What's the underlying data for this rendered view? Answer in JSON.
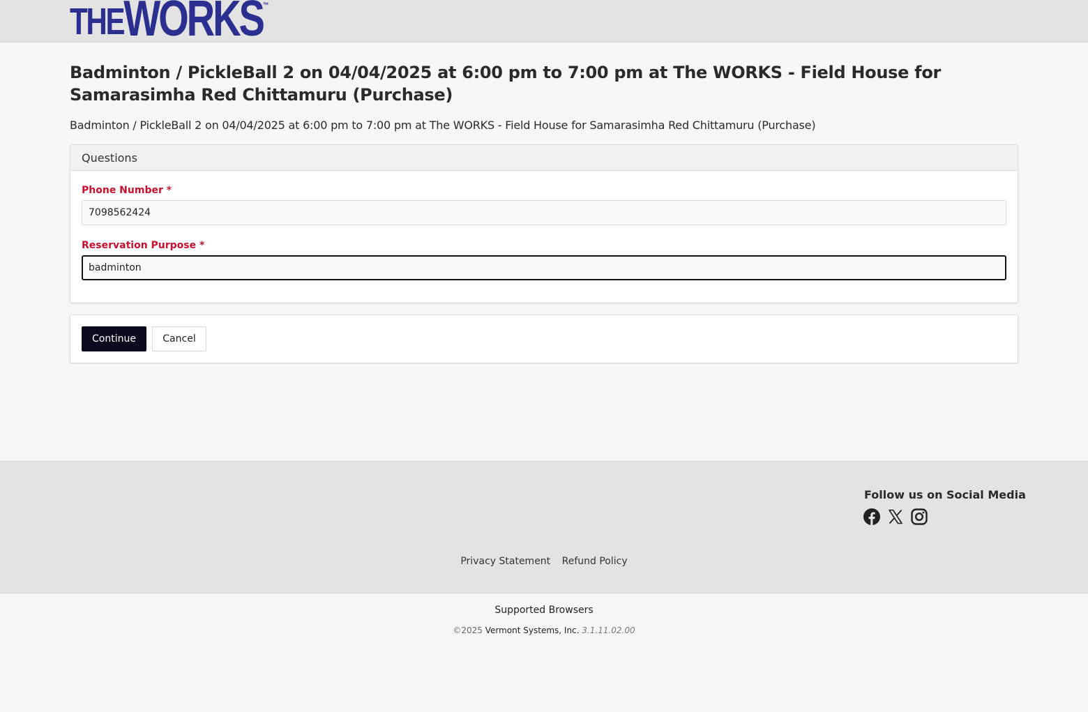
{
  "header": {
    "logo_the": "THE",
    "logo_works": "WORKS",
    "logo_tm": "™",
    "brand_color": "#2b2f8f"
  },
  "page": {
    "title": "Badminton / PickleBall 2 on 04/04/2025 at 6:00 pm to 7:00 pm at The WORKS - Field House for Samarasimha Red Chittamuru (Purchase)",
    "subtitle": "Badminton / PickleBall 2 on 04/04/2025 at 6:00 pm to 7:00 pm at The WORKS - Field House for Samarasimha Red Chittamuru (Purchase)"
  },
  "questions": {
    "heading": "Questions",
    "phone_label": "Phone Number *",
    "phone_value": "7098562424",
    "purpose_label": "Reservation Purpose *",
    "purpose_value": "badminton",
    "required_color": "#c8102e"
  },
  "actions": {
    "continue_label": "Continue",
    "cancel_label": "Cancel"
  },
  "footer": {
    "social_title": "Follow us on Social Media",
    "social_icons": [
      "facebook-icon",
      "x-icon",
      "instagram-icon"
    ],
    "privacy_label": "Privacy Statement",
    "refund_label": "Refund Policy",
    "supported_browsers": "Supported Browsers",
    "copyright_year": "©2025",
    "company": "Vermont Systems, Inc.",
    "version": "3.1.11.02.00"
  }
}
